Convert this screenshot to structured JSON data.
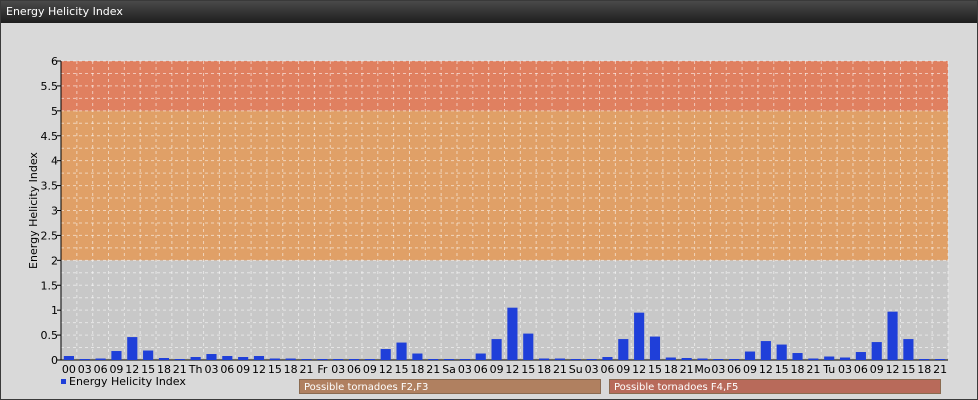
{
  "window": {
    "title": "Energy Helicity Index"
  },
  "colors": {
    "bar": "#1f3fd9",
    "band_possible_f2f3": "#e0a067",
    "band_possible_f4f5": "#e08060",
    "normal_bg": "#c8c8c8",
    "label_f2f3_bg": "#b08060",
    "label_f4f5_bg": "#b86a5a"
  },
  "chart_data": {
    "type": "bar",
    "title": "",
    "ylabel": "Energy Helicity Index",
    "xlabel": "",
    "ylim": [
      0,
      6
    ],
    "yticks": [
      "0",
      "0.5",
      "1",
      "1.5",
      "2",
      "2.5",
      "3",
      "3.5",
      "4",
      "4.5",
      "5",
      "5.5",
      "6"
    ],
    "grid": true,
    "legend": {
      "position": "bottom-left",
      "label": "Energy Helicity Index"
    },
    "categories": [
      "00",
      "03",
      "06",
      "09",
      "12",
      "15",
      "18",
      "21",
      "Th",
      "03",
      "06",
      "09",
      "12",
      "15",
      "18",
      "21",
      "Fr",
      "03",
      "06",
      "09",
      "12",
      "15",
      "18",
      "21",
      "Sa",
      "03",
      "06",
      "09",
      "12",
      "15",
      "18",
      "21",
      "Su",
      "03",
      "06",
      "09",
      "12",
      "15",
      "18",
      "21",
      "Mo",
      "03",
      "06",
      "09",
      "12",
      "15",
      "18",
      "21",
      "Tu",
      "03",
      "06",
      "09",
      "12",
      "15",
      "18",
      "21"
    ],
    "series": [
      {
        "name": "Energy Helicity Index",
        "values": [
          0.08,
          0.02,
          0.03,
          0.18,
          0.46,
          0.19,
          0.04,
          0.02,
          0.06,
          0.12,
          0.08,
          0.06,
          0.08,
          0.03,
          0.03,
          0.02,
          0.02,
          0.02,
          0.02,
          0.02,
          0.22,
          0.35,
          0.13,
          0.02,
          0.02,
          0.02,
          0.13,
          0.42,
          1.05,
          0.53,
          0.03,
          0.03,
          0.02,
          0.02,
          0.06,
          0.42,
          0.95,
          0.47,
          0.05,
          0.04,
          0.03,
          0.02,
          0.02,
          0.17,
          0.38,
          0.31,
          0.14,
          0.03,
          0.07,
          0.05,
          0.16,
          0.36,
          0.97,
          0.42,
          0.02,
          0.02
        ]
      }
    ],
    "bands": [
      {
        "from": 2,
        "to": 5,
        "label": "Possible tornadoes F2,F3"
      },
      {
        "from": 5,
        "to": 6,
        "label": "Possible tornadoes F4,F5"
      }
    ]
  }
}
